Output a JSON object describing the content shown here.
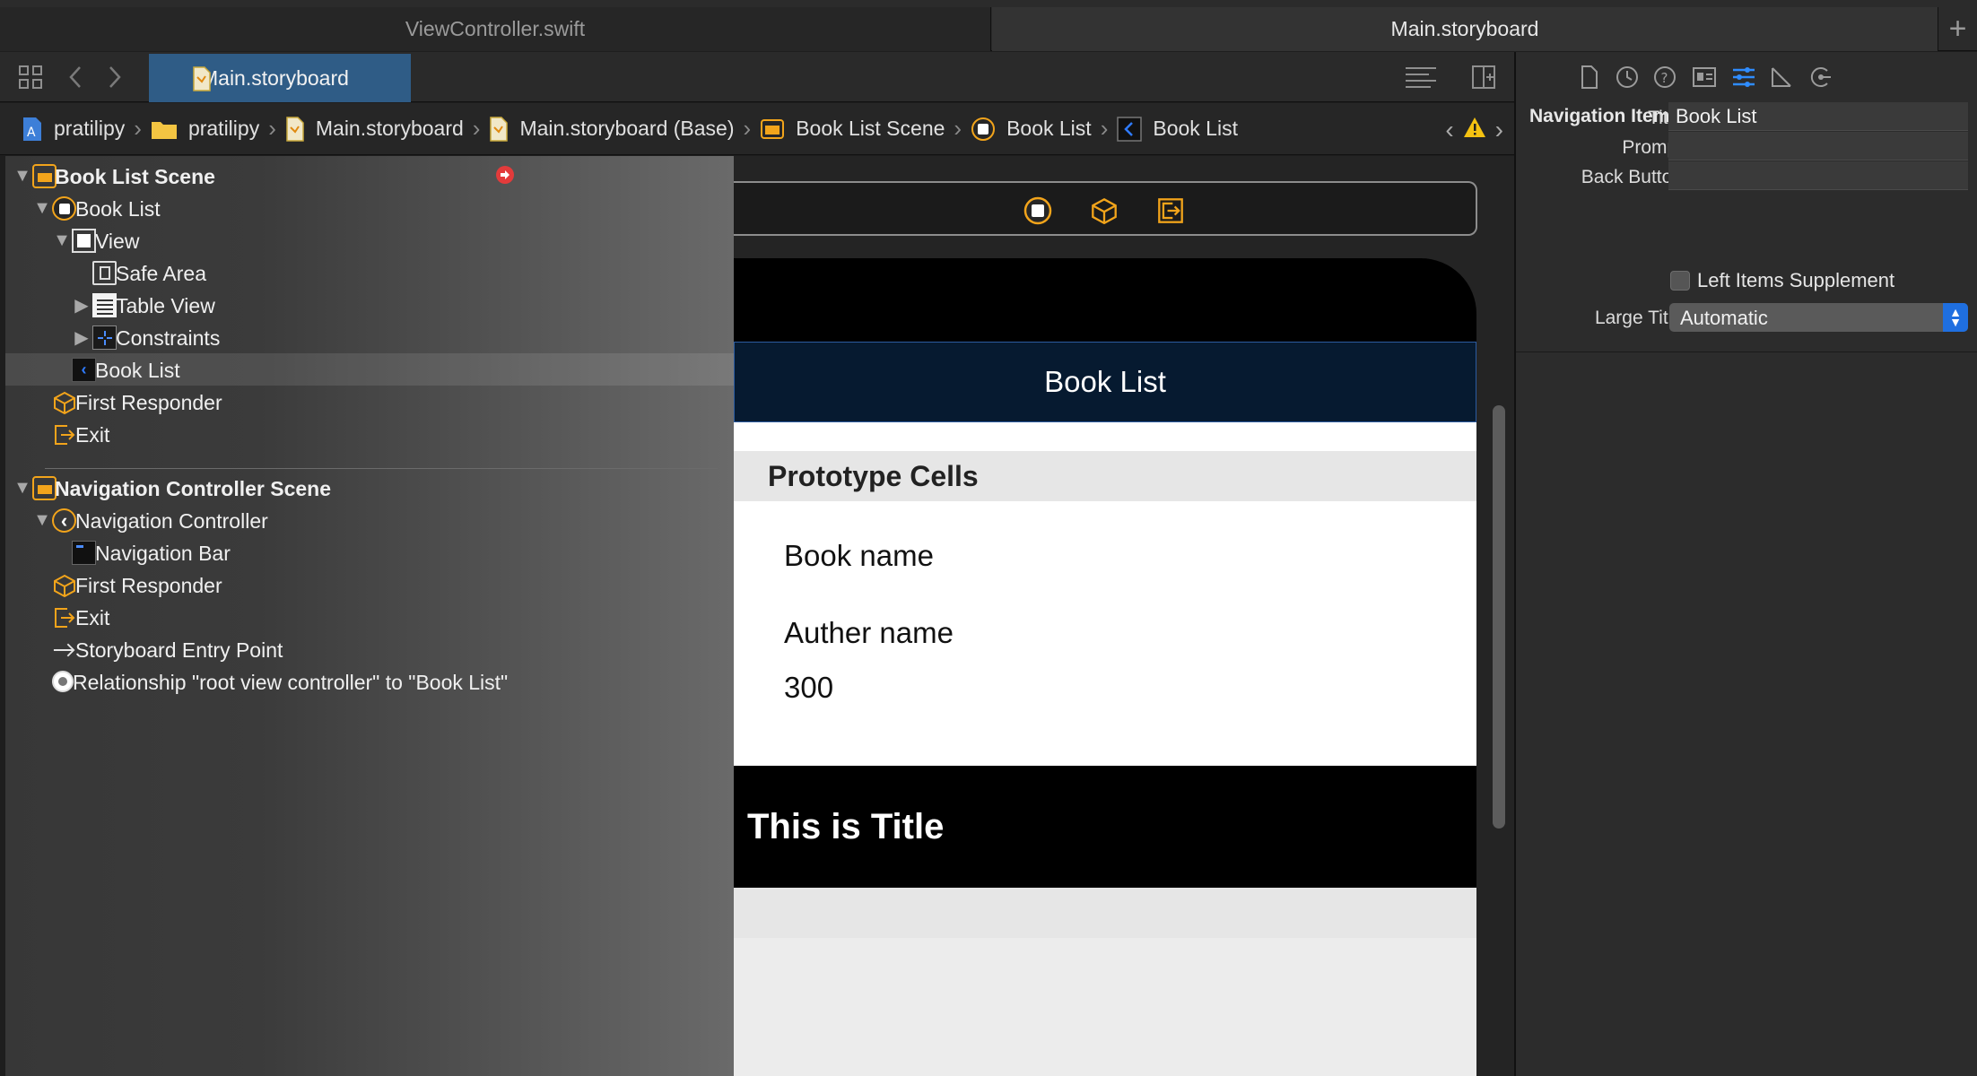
{
  "file_tabs": [
    {
      "label": "ViewController.swift",
      "active": false
    },
    {
      "label": "Main.storyboard",
      "active": true
    }
  ],
  "toolbar": {
    "active_editor_tab": "Main.storyboard"
  },
  "breadcrumb": [
    {
      "label": "pratilipy",
      "icon": "project-icon"
    },
    {
      "label": "pratilipy",
      "icon": "folder-icon"
    },
    {
      "label": "Main.storyboard",
      "icon": "storyboard-file-icon"
    },
    {
      "label": "Main.storyboard (Base)",
      "icon": "storyboard-file-icon"
    },
    {
      "label": "Book List Scene",
      "icon": "scene-icon"
    },
    {
      "label": "Book List",
      "icon": "view-controller-icon"
    },
    {
      "label": "Book List",
      "icon": "navigation-item-icon"
    }
  ],
  "outline": {
    "book_list_scene": "Book List Scene",
    "book_list_vc": "Book List",
    "view": "View",
    "safe_area": "Safe Area",
    "table_view": "Table View",
    "constraints": "Constraints",
    "nav_item": "Book List",
    "first_responder_1": "First Responder",
    "exit_1": "Exit",
    "nav_controller_scene": "Navigation Controller Scene",
    "nav_controller": "Navigation Controller",
    "nav_bar": "Navigation Bar",
    "first_responder_2": "First Responder",
    "exit_2": "Exit",
    "entry_point": "Storyboard Entry Point",
    "relationship": "Relationship \"root view controller\" to \"Book List\""
  },
  "canvas": {
    "nav_title": "Book List",
    "prototype_header": "Prototype Cells",
    "cell_book_name": "Book name",
    "cell_author_name": "Auther name",
    "cell_number": "300",
    "header_title": "This is Title"
  },
  "inspector": {
    "section_title": "Navigation Item",
    "title_label": "Title",
    "title_value": "Book List",
    "prompt_label": "Prompt",
    "prompt_value": "",
    "back_button_label": "Back Button",
    "back_button_value": "",
    "left_items_label": "Left Items Supplement",
    "left_items_checked": false,
    "large_title_label": "Large Title",
    "large_title_value": "Automatic"
  },
  "colors": {
    "accent": "#2f8cff",
    "storyboard_orange": "#f2a41b",
    "nav_bar_bg": "#061a30",
    "selected_tab": "#2f5c86"
  }
}
